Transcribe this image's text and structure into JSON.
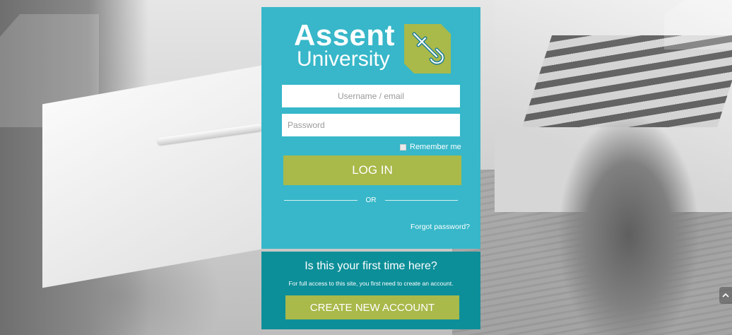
{
  "logo": {
    "word1": "Assent",
    "word2": "University"
  },
  "login": {
    "username_placeholder": "Username / email",
    "password_placeholder": "Password",
    "remember_label": "Remember me",
    "login_button": "LOG IN",
    "or_text": "OR",
    "forgot_link": "Forgot password?"
  },
  "signup": {
    "heading": "Is this your first time here?",
    "description": "For full access to this site, you first need to create an account.",
    "create_button": "CREATE NEW ACCOUNT"
  },
  "icons": {
    "logo_mark": "assent-a-icon",
    "scroll": "chevron-up-icon"
  },
  "colors": {
    "card_top": "#37b7c9",
    "card_bottom": "#0d8f99",
    "button": "#a9b94a",
    "logo_mark": "#a9b94a"
  }
}
